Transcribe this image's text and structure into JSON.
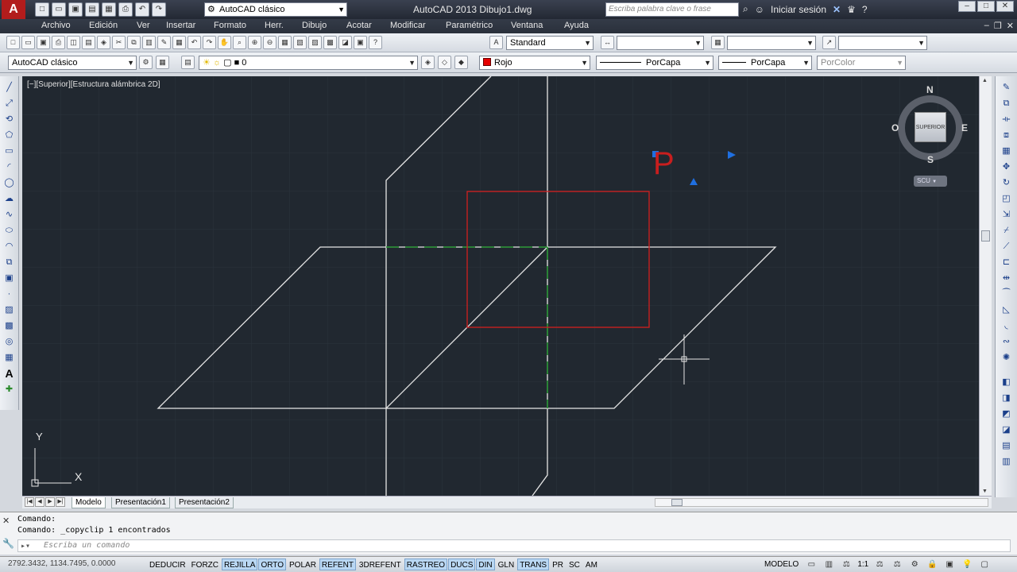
{
  "titlebar": {
    "app_logo": "A",
    "workspace": "AutoCAD clásico",
    "title": "AutoCAD 2013    Dibujo1.dwg",
    "search_placeholder": "Escriba palabra clave o frase",
    "sign_in": "Iniciar sesión",
    "help": "?"
  },
  "menu": {
    "items": [
      "Archivo",
      "Edición",
      "Ver",
      "Insertar",
      "Formato",
      "Herr.",
      "Dibujo",
      "Acotar",
      "Modificar",
      "Paramétrico",
      "Ventana",
      "Ayuda"
    ]
  },
  "toolbar1": {
    "text_style": "Standard",
    "dim_style": "",
    "table_style": "",
    "mleader_style": ""
  },
  "toolbar2": {
    "workspace": "AutoCAD clásico",
    "layer": "0",
    "color": "Rojo",
    "linetype": "PorCapa",
    "lineweight": "PorCapa",
    "plotstyle": "PorColor"
  },
  "canvas": {
    "view_label": "[−][Superior][Estructura alámbrica 2D]",
    "text_object": "P",
    "ucs_x": "X",
    "ucs_y": "Y",
    "viewcube": {
      "face": "SUPERIOR",
      "north": "N",
      "south": "S",
      "east": "E",
      "west": "O"
    },
    "ucs_menu": "SCU"
  },
  "layout_tabs": [
    "Modelo",
    "Presentación1",
    "Presentación2"
  ],
  "command": {
    "history": [
      "Comando:",
      "Comando: _copyclip 1 encontrados"
    ],
    "placeholder": "Escriba un comando"
  },
  "status": {
    "coords": "2792.3432, 1134.7495, 0.0000",
    "toggles": [
      {
        "label": "DEDUCIR",
        "on": false
      },
      {
        "label": "FORZC",
        "on": false
      },
      {
        "label": "REJILLA",
        "on": true
      },
      {
        "label": "ORTO",
        "on": true
      },
      {
        "label": "POLAR",
        "on": false
      },
      {
        "label": "REFENT",
        "on": true
      },
      {
        "label": "3DREFENT",
        "on": false
      },
      {
        "label": "RASTREO",
        "on": true
      },
      {
        "label": "DUCS",
        "on": true
      },
      {
        "label": "DIN",
        "on": true
      },
      {
        "label": "GLN",
        "on": false
      },
      {
        "label": "TRANS",
        "on": true
      },
      {
        "label": "PR",
        "on": false
      },
      {
        "label": "SC",
        "on": false
      },
      {
        "label": "AM",
        "on": false
      }
    ],
    "space": "MODELO",
    "scale": "1:1"
  },
  "colors": {
    "canvas_bg": "#212830",
    "red_rectangle": "#d21e1e",
    "green_hidden": "#1e8c2a",
    "grip_blue": "#1f6fe0"
  }
}
